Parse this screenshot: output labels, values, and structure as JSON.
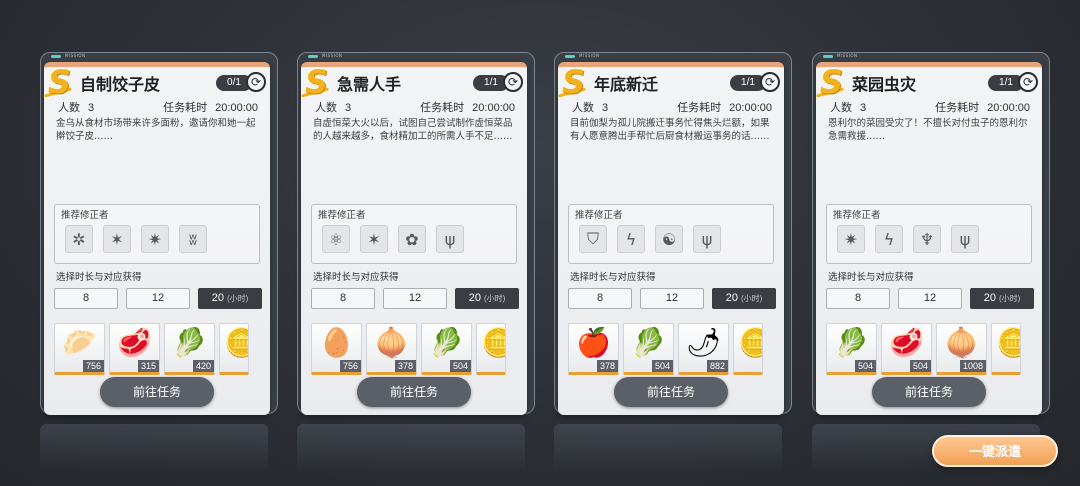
{
  "mission_tag": "MISSION",
  "labels": {
    "count": "人数",
    "time": "任务耗时",
    "recommended": "推荐修正者",
    "duration": "选择时长与对应获得",
    "hours_unit": "(小时)",
    "go": "前往任务"
  },
  "cards": [
    {
      "grade": "S",
      "title": "自制饺子皮",
      "progress": "0/1",
      "count": "3",
      "time": "20:00:00",
      "desc": "金乌从食材市场带来许多面粉，邀请你和她一起擀饺子皮……",
      "rec_icons": [
        "spiky-crystal",
        "six-point-star",
        "star-burst",
        "twin-flame"
      ],
      "durations": [
        "8",
        "12",
        "20"
      ],
      "rewards": [
        {
          "item": "dough-sheets",
          "glyph": "🥟",
          "qty": "756"
        },
        {
          "item": "raw-meat",
          "glyph": "🥩",
          "qty": "315"
        },
        {
          "item": "scallion",
          "glyph": "🥬",
          "qty": "420"
        },
        {
          "item": "coin",
          "glyph": "🪙",
          "qty": ""
        }
      ]
    },
    {
      "grade": "S",
      "title": "急需人手",
      "progress": "1/1",
      "count": "3",
      "time": "20:00:00",
      "desc": "自虚恒菜大火以后，试图自己尝试制作虚恒菜品的人越来越多，食材精加工的所需人手不足……",
      "rec_icons": [
        "atom",
        "six-point-star",
        "flower",
        "trident"
      ],
      "durations": [
        "8",
        "12",
        "20"
      ],
      "rewards": [
        {
          "item": "egg",
          "glyph": "🥚",
          "qty": "756"
        },
        {
          "item": "scallion",
          "glyph": "🧅",
          "qty": "378"
        },
        {
          "item": "bok-choy",
          "glyph": "🥬",
          "qty": "504"
        },
        {
          "item": "coin",
          "glyph": "🪙",
          "qty": ""
        }
      ]
    },
    {
      "grade": "S",
      "title": "年底新迁",
      "progress": "1/1",
      "count": "3",
      "time": "20:00:00",
      "desc": "目前伽梨为孤儿院搬迁事务忙得焦头烂额，如果有人愿意腾出手帮忙后厨食材搬运事务的话……",
      "rec_icons": [
        "shield",
        "lightning",
        "swirl",
        "trident"
      ],
      "durations": [
        "8",
        "12",
        "20"
      ],
      "rewards": [
        {
          "item": "apple",
          "glyph": "🍎",
          "qty": "378"
        },
        {
          "item": "bok-choy",
          "glyph": "🥬",
          "qty": "504"
        },
        {
          "item": "chili",
          "glyph": "🌶",
          "qty": "882"
        },
        {
          "item": "coin",
          "glyph": "🪙",
          "qty": ""
        }
      ]
    },
    {
      "grade": "S",
      "title": "菜园虫灾",
      "progress": "1/1",
      "count": "3",
      "time": "20:00:00",
      "desc": "恩利尔的菜园受灾了！不擅长对付虫子的恩利尔急需救援……",
      "rec_icons": [
        "star-burst",
        "lightning",
        "crest",
        "trident"
      ],
      "durations": [
        "8",
        "12",
        "20"
      ],
      "rewards": [
        {
          "item": "bok-choy",
          "glyph": "🥬",
          "qty": "504"
        },
        {
          "item": "raw-meat",
          "glyph": "🥩",
          "qty": "504"
        },
        {
          "item": "scallion",
          "glyph": "🧅",
          "qty": "1008"
        },
        {
          "item": "coin",
          "glyph": "🪙",
          "qty": ""
        }
      ]
    }
  ],
  "dispatch_all": "一键派遣"
}
